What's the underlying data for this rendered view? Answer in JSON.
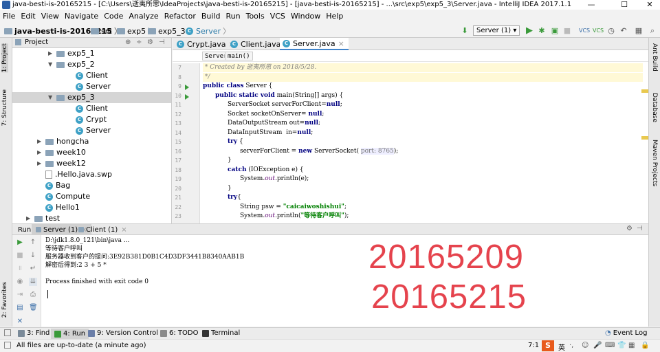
{
  "window": {
    "title": "java-besti-is-20165215 - [C:\\Users\\逝夷所思\\IdeaProjects\\java-besti-is-20165215] - [java-besti-is-20165215] - ...\\src\\exp5\\exp5_3\\Server.java - IntelliJ IDEA 2017.1.1",
    "minimize": "—",
    "maximize": "☐",
    "close": "✕"
  },
  "menu": [
    "File",
    "Edit",
    "View",
    "Navigate",
    "Code",
    "Analyze",
    "Refactor",
    "Build",
    "Run",
    "Tools",
    "VCS",
    "Window",
    "Help"
  ],
  "breadcrumb": [
    "java-besti-is-20165215",
    "src",
    "exp5",
    "exp5_3",
    "Server"
  ],
  "run_config": "Server (1)",
  "project_panel": {
    "title": "Project",
    "tree": [
      {
        "label": "exp5_1",
        "kind": "folder",
        "arrow": "▶"
      },
      {
        "label": "exp5_2",
        "kind": "folder",
        "arrow": "▼"
      },
      {
        "label": "Client",
        "kind": "class",
        "arrow": ""
      },
      {
        "label": "Server",
        "kind": "class",
        "arrow": ""
      },
      {
        "label": "exp5_3",
        "kind": "folder",
        "arrow": "▼"
      },
      {
        "label": "Client",
        "kind": "class",
        "arrow": ""
      },
      {
        "label": "Crypt",
        "kind": "class",
        "arrow": ""
      },
      {
        "label": "Server",
        "kind": "class",
        "arrow": ""
      },
      {
        "label": "hongcha",
        "kind": "folder",
        "arrow": "▶"
      },
      {
        "label": "week10",
        "kind": "folder",
        "arrow": "▶"
      },
      {
        "label": "week12",
        "kind": "folder",
        "arrow": "▶"
      },
      {
        "label": ".Hello.java.swp",
        "kind": "file",
        "arrow": ""
      },
      {
        "label": "Bag",
        "kind": "class",
        "arrow": ""
      },
      {
        "label": "Compute",
        "kind": "class",
        "arrow": ""
      },
      {
        "label": "Hello1",
        "kind": "class",
        "arrow": ""
      },
      {
        "label": "test",
        "kind": "folder",
        "arrow": "▶"
      }
    ]
  },
  "editor": {
    "tabs": [
      "Crypt.java",
      "Client.java",
      "Server.java"
    ],
    "active_tab": "Server.java",
    "crumbs": [
      "Server",
      "main()"
    ],
    "line_numbers": [
      "7",
      "8",
      "9",
      "10",
      "11",
      "12",
      "13",
      "14",
      "15",
      "16",
      "17",
      "18",
      "19",
      "20",
      "21",
      "22",
      "23"
    ],
    "lines": [
      {
        "indent": 0,
        "parts": [
          {
            "t": " * Created by 逝夷所思 on 2018/5/28.",
            "c": "cm"
          }
        ]
      },
      {
        "indent": 0,
        "parts": [
          {
            "t": " */",
            "c": "cm"
          }
        ]
      },
      {
        "indent": 0,
        "parts": [
          {
            "t": "public class",
            "c": "kw"
          },
          {
            "t": " Server {",
            "c": ""
          }
        ]
      },
      {
        "indent": 1,
        "parts": [
          {
            "t": "public static void",
            "c": "kw"
          },
          {
            "t": " main(String[] args) {",
            "c": ""
          }
        ]
      },
      {
        "indent": 2,
        "parts": [
          {
            "t": "ServerSocket serverForClient=",
            "c": ""
          },
          {
            "t": "null",
            "c": "kw"
          },
          {
            "t": ";",
            "c": ""
          }
        ]
      },
      {
        "indent": 2,
        "parts": [
          {
            "t": "Socket socketOnServer= ",
            "c": ""
          },
          {
            "t": "null",
            "c": "kw"
          },
          {
            "t": ";",
            "c": ""
          }
        ]
      },
      {
        "indent": 2,
        "parts": [
          {
            "t": "DataOutputStream out=",
            "c": ""
          },
          {
            "t": "null",
            "c": "kw"
          },
          {
            "t": ";",
            "c": ""
          }
        ]
      },
      {
        "indent": 2,
        "parts": [
          {
            "t": "DataInputStream  in=",
            "c": ""
          },
          {
            "t": "null",
            "c": "kw"
          },
          {
            "t": ";",
            "c": ""
          }
        ]
      },
      {
        "indent": 2,
        "parts": [
          {
            "t": "try",
            "c": "kw"
          },
          {
            "t": " {",
            "c": ""
          }
        ]
      },
      {
        "indent": 3,
        "parts": [
          {
            "t": "serverForClient = ",
            "c": ""
          },
          {
            "t": "new",
            "c": "kw"
          },
          {
            "t": " ServerSocket( ",
            "c": ""
          },
          {
            "t": "port: 8765",
            "c": "hint"
          },
          {
            "t": ");",
            "c": ""
          }
        ]
      },
      {
        "indent": 2,
        "parts": [
          {
            "t": "}",
            "c": ""
          }
        ]
      },
      {
        "indent": 2,
        "parts": [
          {
            "t": "catch",
            "c": "kw"
          },
          {
            "t": " (IOException e) {",
            "c": ""
          }
        ]
      },
      {
        "indent": 3,
        "parts": [
          {
            "t": "System.",
            "c": ""
          },
          {
            "t": "out",
            "c": "fld"
          },
          {
            "t": ".println(e);",
            "c": ""
          }
        ]
      },
      {
        "indent": 2,
        "parts": [
          {
            "t": "}",
            "c": ""
          }
        ]
      },
      {
        "indent": 2,
        "parts": [
          {
            "t": "try",
            "c": "kw"
          },
          {
            "t": "{",
            "c": ""
          }
        ]
      },
      {
        "indent": 3,
        "parts": [
          {
            "t": "String psw = ",
            "c": ""
          },
          {
            "t": "\"caicaiwoshishui\"",
            "c": "str"
          },
          {
            "t": ";",
            "c": ""
          }
        ]
      },
      {
        "indent": 3,
        "parts": [
          {
            "t": "System.",
            "c": ""
          },
          {
            "t": "out",
            "c": "fld"
          },
          {
            "t": ".println(",
            "c": ""
          },
          {
            "t": "\"等待客户呼叫\"",
            "c": "str"
          },
          {
            "t": ");",
            "c": ""
          }
        ]
      }
    ]
  },
  "run_panel": {
    "label": "Run:",
    "tabs": [
      "Server (1)",
      "Client (1)"
    ],
    "console": [
      "D:\\jdk1.8.0_121\\bin\\java ...",
      "等待客户呼叫",
      "服务器收到客户的提问:3E92B381D0B1C4D3DF3441B8340AAB1B",
      "解密后得到:2 3 + 5 *",
      "",
      "Process finished with exit code 0"
    ],
    "overlay_numbers": [
      "20165209",
      "20165215"
    ]
  },
  "left_tool_tabs": [
    "1: Project",
    "7: Structure",
    "2: Favorites"
  ],
  "right_tool_tabs": [
    "Ant Build",
    "Database",
    "Maven Projects"
  ],
  "bottom_tabs": [
    {
      "label": "3: Find",
      "color": "#7a8a99"
    },
    {
      "label": "4: Run",
      "color": "#3a9a3a"
    },
    {
      "label": "9: Version Control",
      "color": "#6a7ea8"
    },
    {
      "label": "6: TODO",
      "color": "#8a8a8a"
    },
    {
      "label": "Terminal",
      "color": "#333333"
    }
  ],
  "event_log": "Event Log",
  "status": {
    "message": "All files are up-to-date (a minute ago)",
    "position": "7:1",
    "ime": "英"
  },
  "colors": {
    "accent": "#4083c9",
    "run_green": "#3a9a3a",
    "overlay_red": "#e5434d"
  }
}
